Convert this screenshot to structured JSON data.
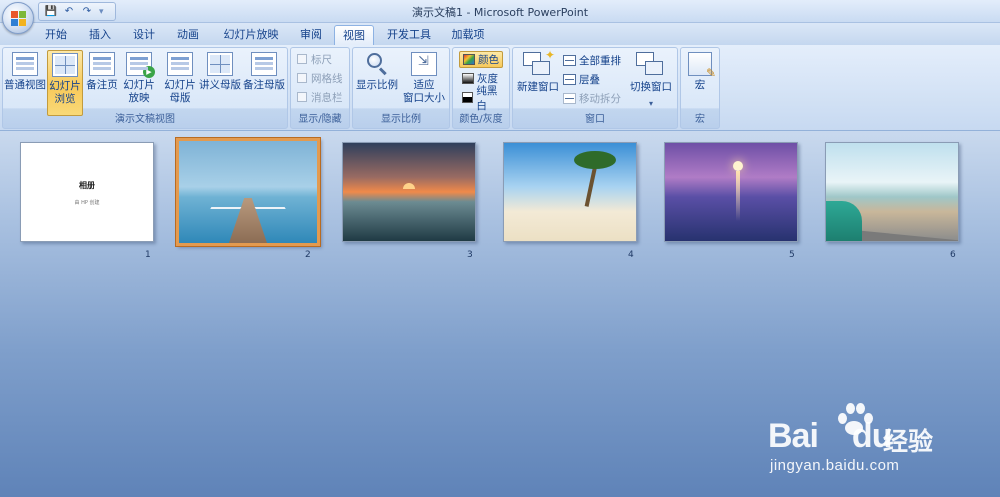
{
  "window": {
    "title": "演示文稿1 - Microsoft PowerPoint"
  },
  "quick_access": {
    "icons": [
      "office-logo",
      "save-icon",
      "undo-icon",
      "redo-icon",
      "customize-icon"
    ]
  },
  "tabs": [
    {
      "label": "开始",
      "active": false
    },
    {
      "label": "插入",
      "active": false
    },
    {
      "label": "设计",
      "active": false
    },
    {
      "label": "动画",
      "active": false
    },
    {
      "label": "幻灯片放映",
      "active": false
    },
    {
      "label": "审阅",
      "active": false
    },
    {
      "label": "视图",
      "active": true
    },
    {
      "label": "开发工具",
      "active": false
    },
    {
      "label": "加载项",
      "active": false
    }
  ],
  "ribbon": {
    "presentation_views": {
      "label": "演示文稿视图",
      "normal": {
        "line1": "普通视图",
        "line2": ""
      },
      "slide_sorter": {
        "line1": "幻灯片",
        "line2": "浏览"
      },
      "notes_page": {
        "line1": "备注页",
        "line2": ""
      },
      "slide_show": {
        "line1": "幻灯片",
        "line2": "放映"
      },
      "slide_master": {
        "line1": "幻灯片",
        "line2": "母版"
      },
      "handout_master": {
        "line1": "讲义母版",
        "line2": ""
      },
      "notes_master": {
        "line1": "备注母版",
        "line2": ""
      }
    },
    "show_hide": {
      "label": "显示/隐藏",
      "ruler": "标尺",
      "gridlines": "网格线",
      "message_bar": "消息栏"
    },
    "zoom": {
      "label": "显示比例",
      "zoom": "显示比例",
      "fit_line1": "适应",
      "fit_line2": "窗口大小"
    },
    "color_grayscale": {
      "label": "颜色/灰度",
      "color": "颜色",
      "grayscale": "灰度",
      "black_white": "纯黑白"
    },
    "window": {
      "label": "窗口",
      "new_window": "新建窗口",
      "arrange_all": "全部重排",
      "cascade": "层叠",
      "move_split": "移动拆分",
      "switch_windows": "切换窗口"
    },
    "macros": {
      "label": "宏",
      "macros": "宏"
    }
  },
  "slides": [
    {
      "number": "1",
      "title": "相册",
      "subtitle": "由 HP 创建",
      "selected": false,
      "thumbnail": "title-slide"
    },
    {
      "number": "2",
      "selected": true,
      "thumbnail": "pier-over-sea"
    },
    {
      "number": "3",
      "selected": false,
      "thumbnail": "sunset-waves"
    },
    {
      "number": "4",
      "selected": false,
      "thumbnail": "palm-beach"
    },
    {
      "number": "5",
      "selected": false,
      "thumbnail": "purple-sunset-coast"
    },
    {
      "number": "6",
      "selected": false,
      "thumbnail": "coastal-road-car"
    }
  ],
  "watermark": {
    "brand": "Bai",
    "brand2": "du",
    "cn": "经验",
    "url": "jingyan.baidu.com"
  },
  "colors": {
    "selection_border": "#e39a4f",
    "active_button": "#f7c95a",
    "ribbon_text": "#15428b"
  }
}
